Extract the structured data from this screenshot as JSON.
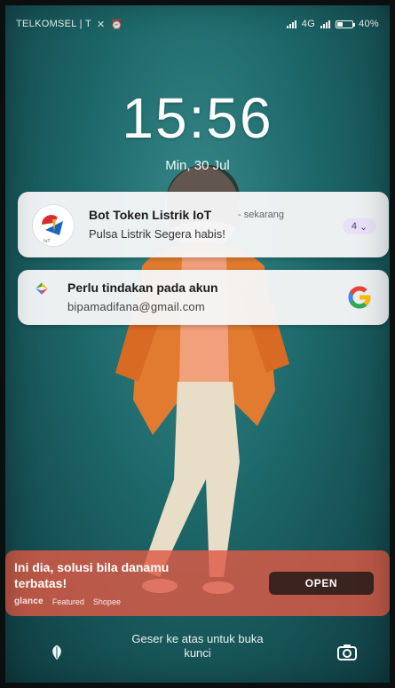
{
  "status_bar": {
    "carrier": "TELKOMSEL | T",
    "network": "4G",
    "battery_text": "40%",
    "battery_level": 0.4
  },
  "lock": {
    "time": "15:56",
    "date": "Min, 30 Jul"
  },
  "notifications": [
    {
      "app_name": "Bot Token Listrik IoT",
      "separator": "-",
      "time": "sekarang",
      "message": "Pulsa Listrik Segera habis!",
      "count": "4",
      "icon": "bot-token-listrik-app-icon"
    },
    {
      "title": "Perlu tindakan pada akun",
      "message": "bipamadifana@gmail.com",
      "icon": "google-play-services-icon",
      "logo": "google-logo"
    }
  ],
  "glance_banner": {
    "headline": "Ini dia, solusi bila danamu terbatas!",
    "brand": "glance",
    "tag1": "Featured",
    "tag2": "Shopee",
    "open_label": "OPEN",
    "background_color": "#de5a46"
  },
  "bottom_bar": {
    "unlock_hint_line1": "Geser ke atas untuk buka",
    "unlock_hint_line2": "kunci",
    "left_icon": "glance-leaf-icon",
    "right_icon": "camera-icon"
  }
}
